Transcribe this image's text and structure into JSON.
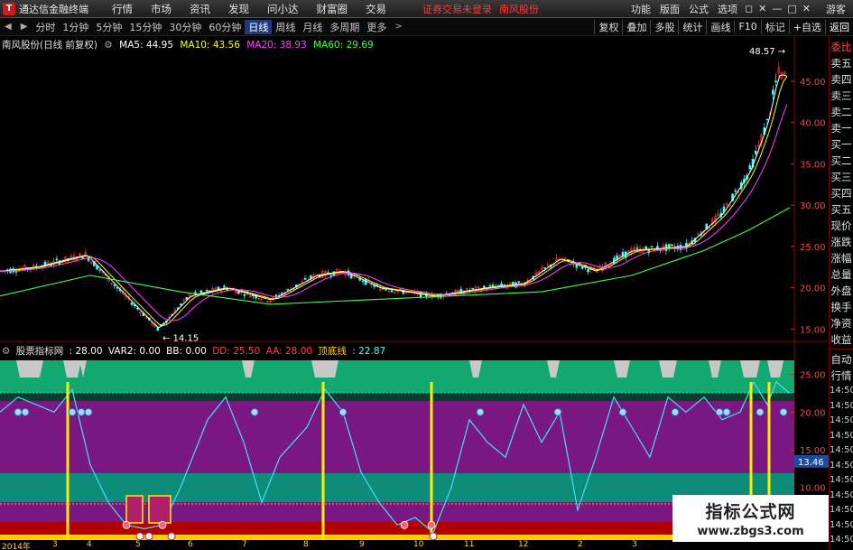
{
  "app": {
    "title": "通达信金融终端",
    "logo": "T"
  },
  "menu": [
    "行情",
    "市场",
    "资讯",
    "发现",
    "问小达",
    "财富圈",
    "交易"
  ],
  "status": {
    "message": "证券交易未登录",
    "stock": "南风股份"
  },
  "right_menu": [
    "功能",
    "版面",
    "公式",
    "选项"
  ],
  "window_buttons": [
    "◻",
    "✕",
    "—",
    "□",
    "✕"
  ],
  "guest_label": "游客",
  "toolbar": {
    "periods": [
      "分时",
      "1分钟",
      "5分钟",
      "15分钟",
      "30分钟",
      "60分钟",
      "日线",
      "周线",
      "月线",
      "多周期",
      "更多"
    ],
    "active_period": "日线",
    "tools": [
      "复权",
      "叠加",
      "多股",
      "统计",
      "画线",
      "F10",
      "标记",
      "+自选",
      "返回"
    ]
  },
  "main_chart": {
    "title": "南风股份(日线 前复权)",
    "ma": [
      {
        "label": "MA5: 44.95",
        "color": "#ffffff"
      },
      {
        "label": "MA10: 43.56",
        "color": "#ffff00"
      },
      {
        "label": "MA20: 38.93",
        "color": "#ff40ff"
      },
      {
        "label": "MA60: 29.69",
        "color": "#40ff40"
      }
    ],
    "y_ticks": [
      "45.00",
      "40.00",
      "35.00",
      "30.00",
      "25.00",
      "20.00",
      "15.00"
    ],
    "high_label": "48.57",
    "low_label": "14.15"
  },
  "indicator": {
    "name": "股票指标网",
    "values": [
      {
        "label": ": 28.00",
        "color": "#ffffff"
      },
      {
        "label": "VAR2: 0.00",
        "color": "#ffffff"
      },
      {
        "label": "BB: 0.00",
        "color": "#ffffff"
      },
      {
        "label": "DD: 25.50",
        "color": "#ff4040"
      },
      {
        "label": "AA: 28.00",
        "color": "#ff4040"
      },
      {
        "label": "顶底线",
        "color": "#ffd000"
      },
      {
        "label": ": 22.87",
        "color": "#40ffff"
      }
    ],
    "y_ticks": [
      "25.00",
      "20.00",
      "15.00",
      "10.00"
    ],
    "current_value": "13.46"
  },
  "right_panel": {
    "top_items": [
      "委比",
      "卖五",
      "卖四",
      "卖三",
      "卖二",
      "卖一",
      "买一",
      "买二",
      "买三",
      "买四",
      "买五",
      "现价",
      "涨跌",
      "涨幅",
      "总量",
      "外盘",
      "换手",
      "净资",
      "收益"
    ],
    "bottom_items": [
      "自动",
      "行情"
    ],
    "times": [
      "14:50",
      "14:50",
      "14:50",
      "14:50",
      "14:50",
      "14:50",
      "14:50",
      "14:50",
      "14:50",
      "14:50",
      "14:50"
    ]
  },
  "x_axis": [
    "2014年",
    "3",
    "4",
    "5",
    "6",
    "7",
    "8",
    "9",
    "10",
    "11",
    "12",
    "2",
    "3"
  ],
  "watermark": {
    "title": "指标公式网",
    "url": "www.zbgs3.com"
  },
  "colors": {
    "ma5": "#ffffff",
    "ma10": "#ffff00",
    "ma20": "#ff40ff",
    "ma60": "#40ff40",
    "up": "#ff3030",
    "down": "#40ffff",
    "band_green": "#13a870",
    "band_purple": "#7a1780",
    "band_teal": "#0e8c7a",
    "band_red": "#b00000",
    "curve": "#40e0ff"
  }
}
